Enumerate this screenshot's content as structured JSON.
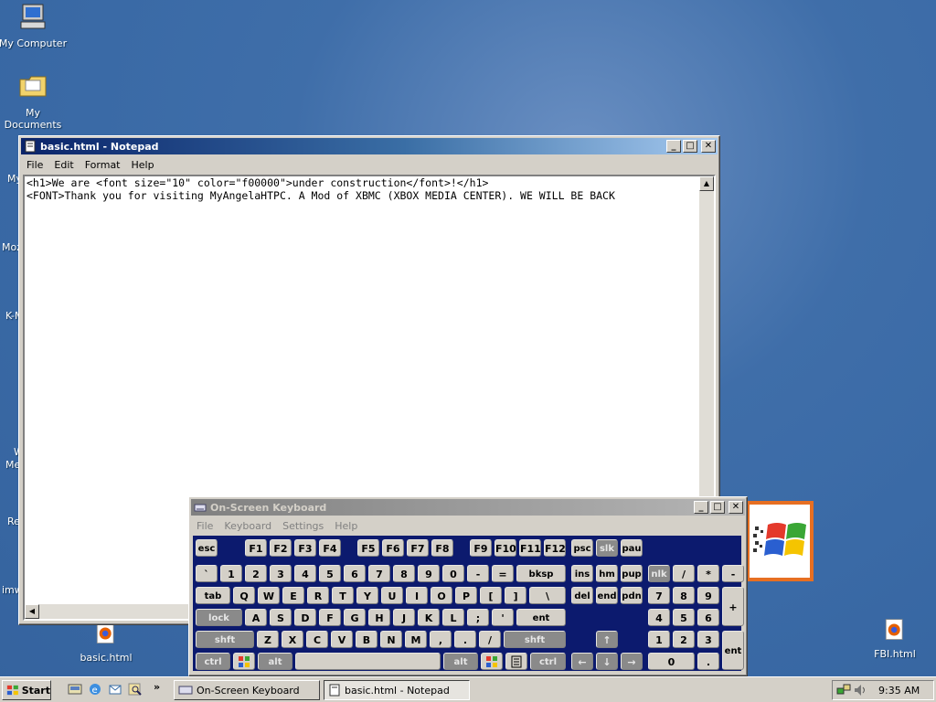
{
  "desktop": {
    "icons": [
      {
        "label": "My Computer"
      },
      {
        "label": "My Documents"
      },
      {
        "label": "basic.html"
      },
      {
        "label": "FBI.html"
      }
    ],
    "clipped_labels": [
      "My",
      "Moz",
      "K-M",
      "W",
      "Me",
      "Re",
      "imw"
    ]
  },
  "notepad": {
    "title": "basic.html - Notepad",
    "menu": [
      "File",
      "Edit",
      "Format",
      "Help"
    ],
    "lines": [
      "<h1>We are <font size=\"10\" color=\"f00000\">under construction</font>!</h1>",
      "<FONT>Thank you for visiting MyAngelaHTPC. A Mod of XBMC (XBOX MEDIA CENTER). WE WILL BE BACK"
    ]
  },
  "osk": {
    "title": "On-Screen Keyboard",
    "menu": [
      "File",
      "Keyboard",
      "Settings",
      "Help"
    ],
    "keys": {
      "esc": "esc",
      "f": [
        "F1",
        "F2",
        "F3",
        "F4",
        "F5",
        "F6",
        "F7",
        "F8",
        "F9",
        "F10",
        "F11",
        "F12"
      ],
      "psc": "psc",
      "slk": "slk",
      "pau": "pau",
      "row1": [
        "`",
        "1",
        "2",
        "3",
        "4",
        "5",
        "6",
        "7",
        "8",
        "9",
        "0",
        "-",
        "="
      ],
      "bksp": "bksp",
      "ins": "ins",
      "hm": "hm",
      "pup": "pup",
      "nlk": "nlk",
      "slash": "/",
      "star": "*",
      "minus": "-",
      "tab": "tab",
      "row2": [
        "Q",
        "W",
        "E",
        "R",
        "T",
        "Y",
        "U",
        "I",
        "O",
        "P",
        "[",
        "]",
        "\\"
      ],
      "del": "del",
      "end": "end",
      "pdn": "pdn",
      "n7": "7",
      "n8": "8",
      "n9": "9",
      "plus": "+",
      "lock": "lock",
      "row3": [
        "A",
        "S",
        "D",
        "F",
        "G",
        "H",
        "J",
        "K",
        "L",
        ";",
        "'"
      ],
      "ent": "ent",
      "n4": "4",
      "n5": "5",
      "n6": "6",
      "shft": "shft",
      "row4": [
        "Z",
        "X",
        "C",
        "V",
        "B",
        "N",
        "M",
        ",",
        ".",
        "/"
      ],
      "up": "↑",
      "n1": "1",
      "n2": "2",
      "n3": "3",
      "nent": "ent",
      "ctrl": "ctrl",
      "alt": "alt",
      "left": "←",
      "down": "↓",
      "right": "→",
      "n0": "0",
      "ndot": "."
    }
  },
  "taskbar": {
    "start": "Start",
    "chevron": "»",
    "tasks": [
      "On-Screen Keyboard",
      "basic.html - Notepad"
    ],
    "clock": "9:35 AM"
  },
  "colors": {
    "desktop": "#3a6aa6",
    "titlebar_active": "#0a246a",
    "osk_background": "#0c1a6e",
    "face": "#d4d0c8"
  }
}
